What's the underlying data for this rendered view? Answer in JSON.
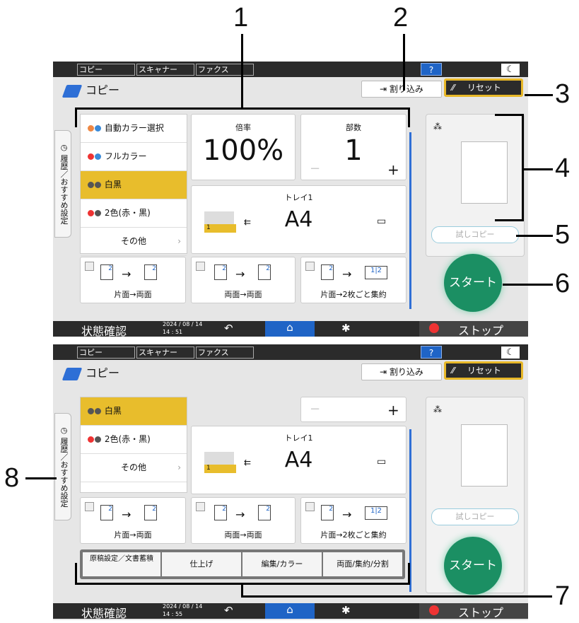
{
  "tabs": [
    "コピー",
    "スキャナー",
    "ファクス"
  ],
  "help_label": "?",
  "title": "コピー",
  "interrupt_label": "割り込み",
  "reset_label": "リセット",
  "side_tab_label": "履歴／おすすめ設定",
  "colors": [
    {
      "label": "自動カラー選択",
      "selected": false
    },
    {
      "label": "フルカラー",
      "selected": false
    },
    {
      "label": "白黒",
      "selected": true
    },
    {
      "label": "2色(赤・黒)",
      "selected": false
    },
    {
      "label": "その他",
      "selected": false
    }
  ],
  "ratio": {
    "label": "倍率",
    "value": "100%"
  },
  "copies": {
    "label": "部数",
    "value": "1",
    "minus": "−",
    "plus": "+"
  },
  "tray": {
    "label": "トレイ1",
    "paper": "A4",
    "num": "1"
  },
  "duplex": [
    {
      "label": "片面→両面"
    },
    {
      "label": "両面→両面"
    },
    {
      "label": "片面→2枚ごと集約"
    }
  ],
  "bottom_tabs": [
    "原稿設定／文書蓄積",
    "仕上げ",
    "編集/カラー",
    "両面/集約/分割"
  ],
  "trial_label": "試しコピー",
  "start_label": "スタート",
  "status_label": "状態確認",
  "date": "2024 / 08 / 14",
  "time1": "14 : 51",
  "time2": "14 : 55",
  "stop_label": "ストップ",
  "callouts": [
    "1",
    "2",
    "3",
    "4",
    "5",
    "6",
    "7",
    "8"
  ]
}
